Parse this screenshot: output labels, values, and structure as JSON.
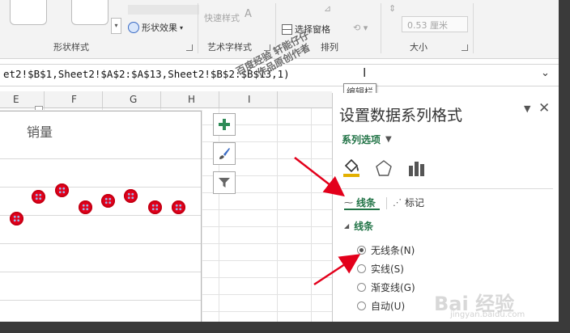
{
  "ribbon": {
    "shape_styles_label": "形状样式",
    "shape_effect_label": "形状效果",
    "wordart_styles_label": "艺术字样式",
    "quick_styles_label": "快速样式",
    "arrange_label": "排列",
    "selection_pane_label": "选择窗格",
    "size_label": "大小",
    "height_value": "0.53 厘米"
  },
  "formula_bar": {
    "text": "et2!$B$1,Sheet2!$A$2:$A$13,Sheet2!$B$2:$B$13,1)",
    "tooltip": "编辑栏"
  },
  "columns": [
    "E",
    "F",
    "G",
    "H",
    "I"
  ],
  "chart": {
    "title": "销量",
    "marker_color": "#e3001b"
  },
  "chart_buttons": [
    {
      "icon": "plus-icon"
    },
    {
      "icon": "brush-icon"
    },
    {
      "icon": "filter-icon"
    }
  ],
  "pane": {
    "title": "设置数据系列格式",
    "series_options_label": "系列选项",
    "tab_line": "线条",
    "tab_marker": "标记",
    "section_title": "线条",
    "options": [
      {
        "label": "无线条(N)",
        "checked": true
      },
      {
        "label": "实线(S)",
        "checked": false
      },
      {
        "label": "渐变线(G)",
        "checked": false
      },
      {
        "label": "自动(U)",
        "checked": false
      }
    ],
    "accent_color": "#217346"
  },
  "watermark": {
    "line1": "百度经验 轩能仔仔",
    "line2": "作品原创作者",
    "logo": "Bai 经验",
    "url": "jingyan.baidu.com"
  }
}
